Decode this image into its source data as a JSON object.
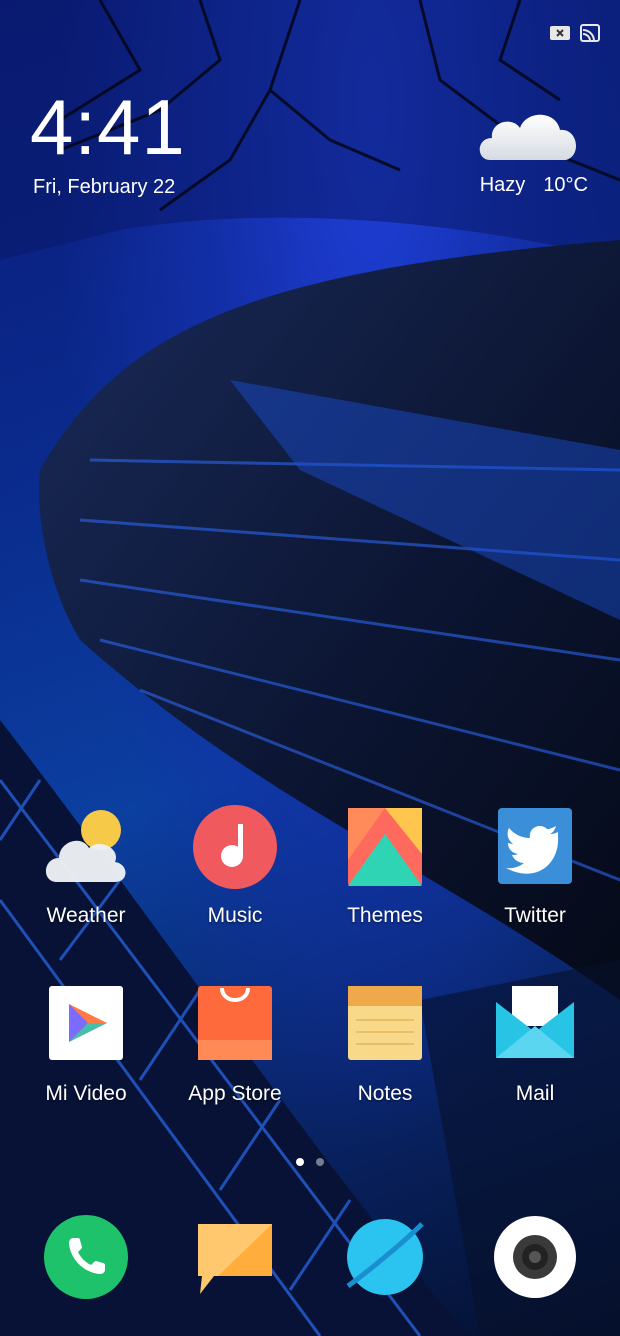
{
  "status_bar": {
    "icons": [
      "notification-icon",
      "cast-icon"
    ]
  },
  "lockclock": {
    "time": "4:41",
    "date": "Fri, February 22"
  },
  "weather": {
    "condition": "Hazy",
    "temperature": "10°C",
    "icon": "cloud-icon"
  },
  "home_apps": [
    {
      "label": "Weather",
      "icon": "weather-icon"
    },
    {
      "label": "Music",
      "icon": "music-icon"
    },
    {
      "label": "Themes",
      "icon": "themes-icon"
    },
    {
      "label": "Twitter",
      "icon": "twitter-icon"
    },
    {
      "label": "Mi Video",
      "icon": "mi-video-icon"
    },
    {
      "label": "App Store",
      "icon": "app-store-icon"
    },
    {
      "label": "Notes",
      "icon": "notes-icon"
    },
    {
      "label": "Mail",
      "icon": "mail-icon"
    }
  ],
  "page_indicator": {
    "pages": 2,
    "active": 1
  },
  "dock": [
    {
      "icon": "phone-icon"
    },
    {
      "icon": "messages-icon"
    },
    {
      "icon": "browser-icon"
    },
    {
      "icon": "camera-icon"
    }
  ],
  "colors": {
    "phone": "#1ec26a",
    "music": "#f05a5f",
    "twitter": "#3a8fd8",
    "notes": "#f8d98a",
    "mail": "#27c4e6",
    "app_store": "#ff6a3d"
  }
}
